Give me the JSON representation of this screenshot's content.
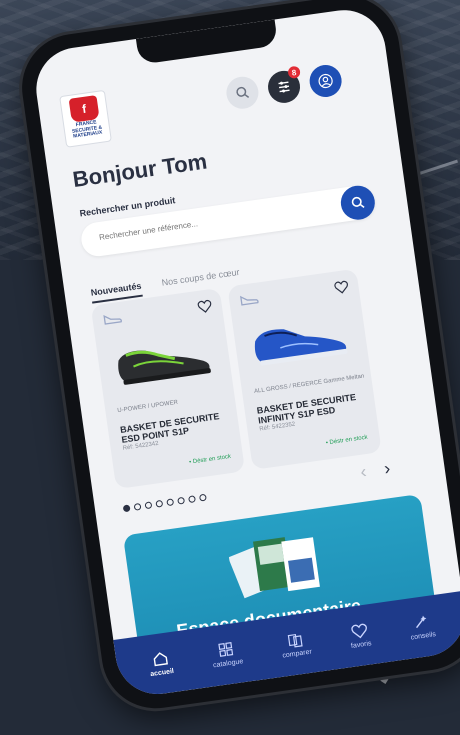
{
  "brand": {
    "logo_initial": "f",
    "logo_text": "FRANCE SECURITE & MATERIAUX"
  },
  "header": {
    "notification_count": "8"
  },
  "greeting": "Bonjour Tom",
  "search": {
    "label": "Rechercher un produit",
    "placeholder": "Rechercher une référence..."
  },
  "tabs": [
    {
      "label": "Nouveautés",
      "active": true
    },
    {
      "label": "Nos coups de cœur",
      "active": false
    }
  ],
  "products": [
    {
      "brand_line": "U-POWER / UPOWER",
      "name": "BASKET DE SECURITE ESD POINT S1P",
      "ref": "Réf: 5422342",
      "stock": "• Déstr en stock",
      "accent": "#7bd43a"
    },
    {
      "brand_line": "ALL GROSS / REGERCE Gamme Meltan",
      "name": "BASKET DE SECURITE INFINITY S1P ESD",
      "ref": "Réf: 5422352",
      "stock": "• Déstr en stock",
      "accent": "#2556c7"
    }
  ],
  "carousel": {
    "total_pages": 8,
    "current": 1
  },
  "doc_banner": {
    "title": "Espace documentaire"
  },
  "bottom_nav": [
    {
      "label": "accueil",
      "icon": "home-icon",
      "active": true
    },
    {
      "label": "catalogue",
      "icon": "catalogue-icon",
      "active": false
    },
    {
      "label": "comparer",
      "icon": "compare-icon",
      "active": false
    },
    {
      "label": "favoris",
      "icon": "heart-icon",
      "active": false
    },
    {
      "label": "conseils",
      "icon": "tips-icon",
      "active": false
    }
  ],
  "colors": {
    "primary": "#1e4fb5",
    "nav_bg": "#1e3a8a",
    "badge": "#e22c36",
    "banner": "#27a0c4"
  }
}
